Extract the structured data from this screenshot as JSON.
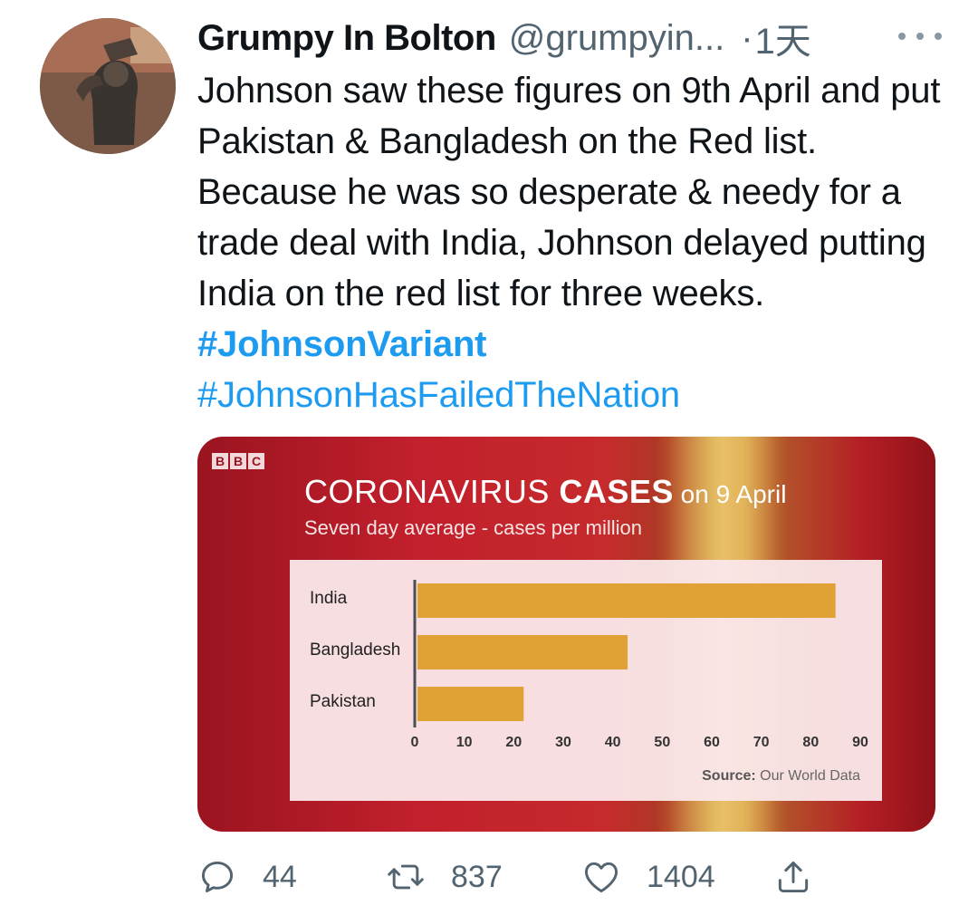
{
  "tweet": {
    "display_name": "Grumpy In Bolton",
    "handle": "@grumpyin...",
    "separator": "·",
    "time": "1天",
    "text_plain": "Johnson saw these figures on 9th April and put Pakistan & Bangladesh on the Red list. Because he was so desperate & needy for a trade deal with India, Johnson delayed putting India on the red list for three weeks. ",
    "hashtag_1": "#JohnsonVariant",
    "hashtag_2": "#JohnsonHasFailedTheNation",
    "more_icon": "more-icon"
  },
  "media": {
    "logo": [
      "B",
      "B",
      "C"
    ],
    "title_part1": "CORONAVIRUS ",
    "title_part2": "CASES",
    "title_part3": " on 9 April",
    "subtitle": "Seven day average - cases per million",
    "source_label": "Source:",
    "source_value": " Our World Data"
  },
  "chart_data": {
    "type": "bar",
    "orientation": "horizontal",
    "categories": [
      "India",
      "Bangladesh",
      "Pakistan"
    ],
    "values": [
      85,
      43,
      22
    ],
    "xlim": [
      0,
      90
    ],
    "xticks": [
      0,
      10,
      20,
      30,
      40,
      50,
      60,
      70,
      80,
      90
    ],
    "bar_color": "#e0a234"
  },
  "actions": {
    "reply_count": "44",
    "retweet_count": "837",
    "like_count": "1404",
    "reply_icon": "reply-icon",
    "retweet_icon": "retweet-icon",
    "like_icon": "heart-icon",
    "share_icon": "share-icon"
  },
  "colors": {
    "link": "#1d9bf0",
    "secondary_text": "#536471",
    "chart_bar": "#e0a234"
  }
}
